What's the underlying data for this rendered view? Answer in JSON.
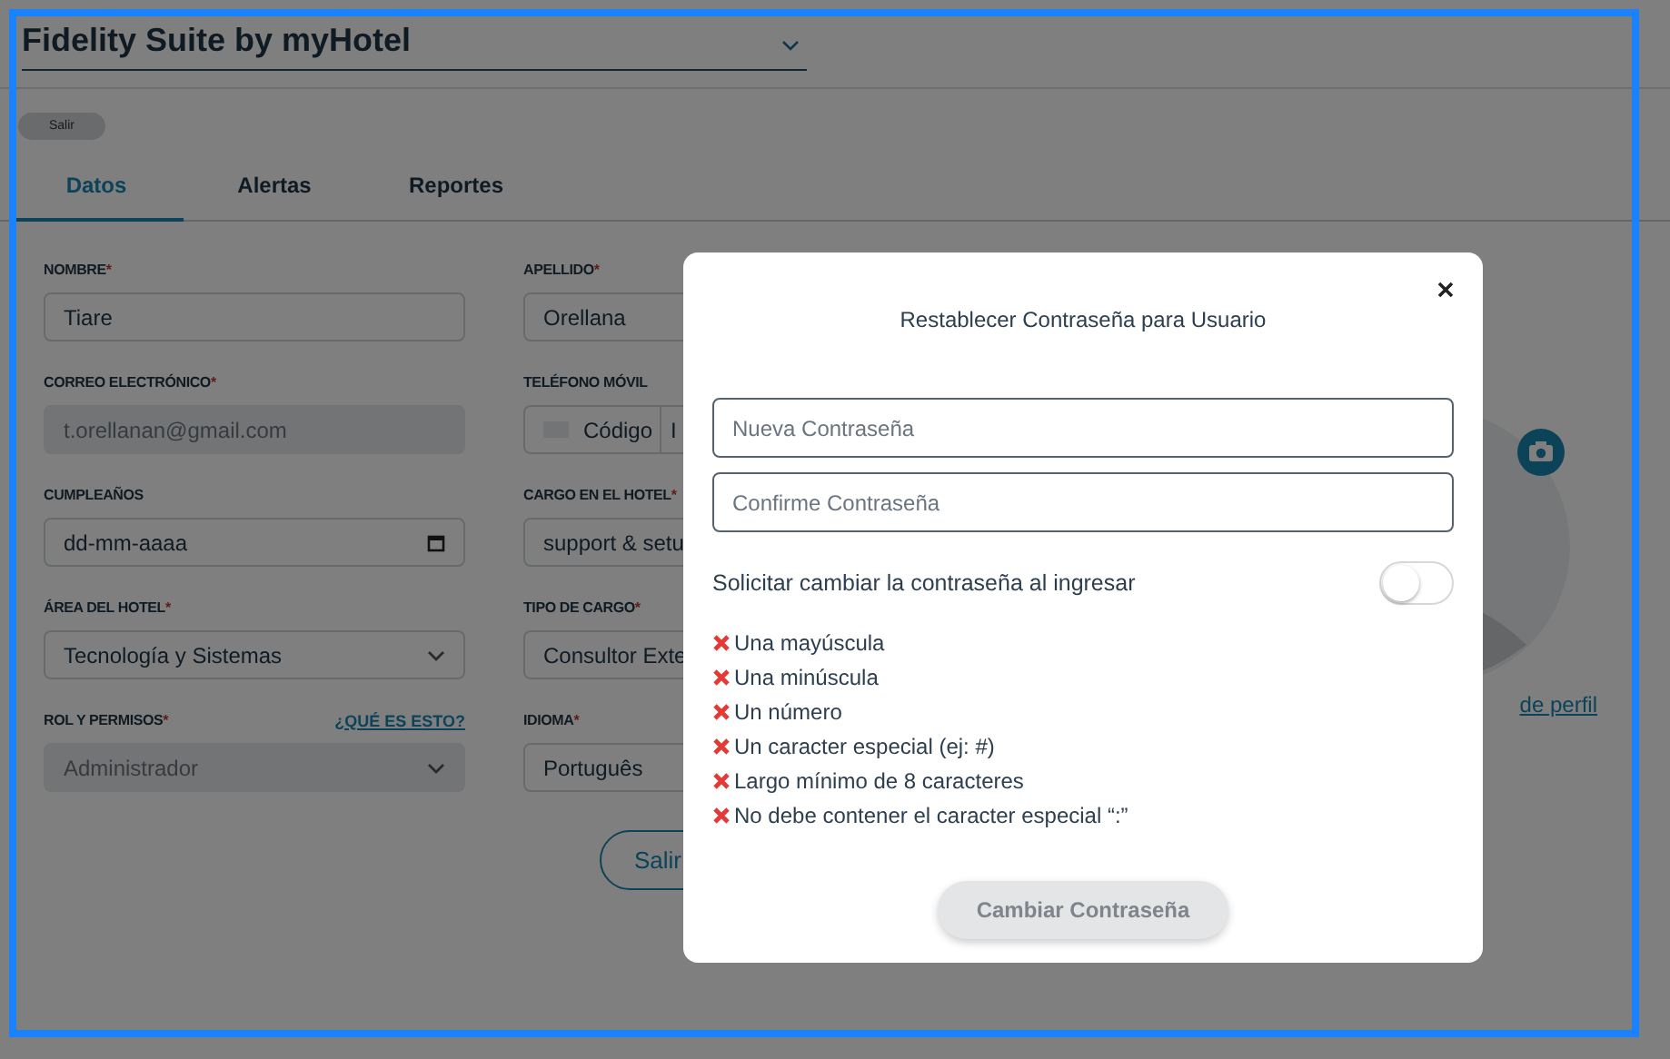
{
  "header": {
    "title": "Fidelity Suite by myHotel",
    "exit_button": "Salir"
  },
  "tabs": [
    {
      "label": "Datos",
      "selected": true
    },
    {
      "label": "Alertas",
      "selected": false
    },
    {
      "label": "Reportes",
      "selected": false
    }
  ],
  "form": {
    "fields": [
      {
        "kind": "text",
        "label": "NOMBRE",
        "required_mark": "*",
        "value": "Tiare",
        "disabled": false
      },
      {
        "kind": "text",
        "label": "APELLIDO",
        "required_mark": "*",
        "value": "Orellana",
        "disabled": false
      },
      {
        "kind": "text",
        "label": "CORREO ELECTRÓNICO",
        "required_mark": "*",
        "value": "t.orellanan@gmail.com",
        "disabled": true
      },
      {
        "kind": "phone",
        "label": "TELÉFONO MÓVIL",
        "code": "Código",
        "value": "I"
      },
      {
        "kind": "date",
        "label": "CUMPLEAÑOS",
        "value": "dd-mm-aaaa",
        "disabled": false
      },
      {
        "kind": "text",
        "label": "CARGO EN EL HOTEL",
        "required_mark": "*",
        "value": "support & setu",
        "disabled": false
      },
      {
        "kind": "select",
        "label": "ÁREA DEL HOTEL",
        "required_mark": "*",
        "value": "Tecnología y Sistemas",
        "disabled": false
      },
      {
        "kind": "text",
        "label": "TIPO DE CARGO",
        "required_mark": "*",
        "value": "Consultor Exte",
        "disabled": false
      },
      {
        "kind": "select",
        "label": "ROL Y PERMISOS",
        "required_mark": "*",
        "link": "¿QUÉ ES ESTO?",
        "value": "Administrador",
        "disabled": true
      },
      {
        "kind": "text",
        "label": "IDIOMA",
        "required_mark": "*",
        "value": "Português",
        "disabled": false
      }
    ],
    "exit_button": "Salir"
  },
  "profile": {
    "photo_link": "de perfil"
  },
  "dialog": {
    "title": "Restablecer Contraseña para Usuario",
    "fields": [
      {
        "placeholder": "Nueva Contraseña"
      },
      {
        "placeholder": "Confirme Contraseña"
      }
    ],
    "toggle": {
      "label": "Solicitar cambiar la contraseña al ingresar",
      "on": false
    },
    "requirements": [
      {
        "text": "Una mayúscula",
        "met": false
      },
      {
        "text": "Una minúscula",
        "met": false
      },
      {
        "text": "Un número",
        "met": false
      },
      {
        "text": "Un caracter especial (ej: #)",
        "met": false
      },
      {
        "text": "Largo mínimo de 8 caracteres",
        "met": false
      },
      {
        "text": "No debe contener el caracter especial “:”",
        "met": false
      }
    ],
    "submit_button": {
      "label": "Cambiar Contraseña",
      "disabled": true
    }
  }
}
